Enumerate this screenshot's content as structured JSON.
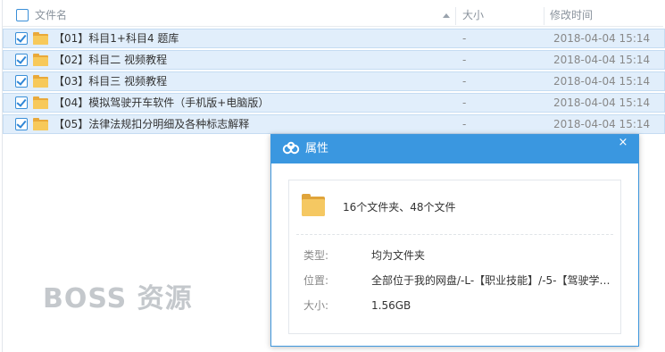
{
  "header": {
    "name_label": "文件名",
    "size_label": "大小",
    "time_label": "修改时间"
  },
  "rows": [
    {
      "name": "【01】科目1+科目4 题库",
      "size": "-",
      "time": "2018-04-04 15:14"
    },
    {
      "name": "【02】科目二 视频教程",
      "size": "-",
      "time": "2018-04-04 15:14"
    },
    {
      "name": "【03】科目三 视频教程",
      "size": "-",
      "time": "2018-04-04 15:14"
    },
    {
      "name": "【04】模拟驾驶开车软件（手机版+电脑版）",
      "size": "-",
      "time": "2018-04-04 15:14"
    },
    {
      "name": "【05】法律法规扣分明细及各种标志解释",
      "size": "-",
      "time": "2018-04-04 15:14"
    }
  ],
  "watermark": "BOSS 资源",
  "dialog": {
    "title": "属性",
    "close": "×",
    "summary": "16个文件夹、48个文件",
    "type_label": "类型:",
    "type_value": "均为文件夹",
    "location_label": "位置:",
    "location_value": "全部位于我的网盘/-L-【职业技能】/-5-【驾驶学…",
    "size_label": "大小:",
    "size_value": "1.56GB"
  },
  "colors": {
    "accent": "#3a97e0",
    "row_selected": "#e1eefb",
    "folder": "#f7c95a"
  },
  "icons": {
    "header_checkbox": "checkbox-icon",
    "sort": "sort-arrow-icon",
    "folder": "folder-icon",
    "cloud": "baidu-cloud-icon",
    "close": "close-icon"
  }
}
